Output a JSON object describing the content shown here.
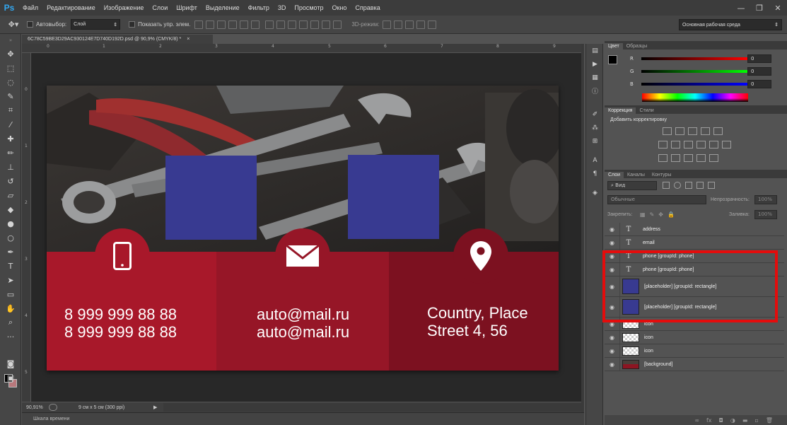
{
  "app": {
    "logo": "Ps"
  },
  "menu": [
    "Файл",
    "Редактирование",
    "Изображение",
    "Слои",
    "Шрифт",
    "Выделение",
    "Фильтр",
    "3D",
    "Просмотр",
    "Окно",
    "Справка"
  ],
  "window_controls": [
    "—",
    "❐",
    "✕"
  ],
  "options": {
    "autoselect_label": "Автовыбор:",
    "autoselect_value": "Слой",
    "show_transform_label": "Показать упр. элем.",
    "mode3d_label": "3D-режим:",
    "workspace": "Основная рабочая среда"
  },
  "document": {
    "tab_title": "6C78C59BE3D29AC930124E7D740D192D.psd @ 90,9% (CMYK/8) *",
    "tab_close": "×",
    "ruler_h_labels": [
      "0",
      "1",
      "2",
      "3",
      "4",
      "5",
      "6",
      "7",
      "8",
      "9"
    ],
    "ruler_v_labels": [
      "0",
      "1",
      "2",
      "3",
      "4",
      "5"
    ]
  },
  "card": {
    "phone_line1": "8 999 999 88 88",
    "phone_line2": "8 999 999 88 88",
    "email_line1": "auto@mail.ru",
    "email_line2": "auto@mail.ru",
    "address_line1": "Country, Place",
    "address_line2": "Street 4, 56",
    "colors": {
      "col1": "#a8182a",
      "col2": "#961627",
      "col3": "#7c1120",
      "placeholder": "#383a91"
    }
  },
  "status": {
    "zoom": "90,91%",
    "doc_info": "9 см x 5 см (300 ppi)"
  },
  "timeline": {
    "label": "Шкала времени"
  },
  "color_panel": {
    "tabs": [
      "Цвет",
      "Образцы"
    ],
    "channels": [
      {
        "letter": "R",
        "value": "0"
      },
      {
        "letter": "G",
        "value": "0"
      },
      {
        "letter": "B",
        "value": "0"
      }
    ]
  },
  "adjustments_panel": {
    "tabs": [
      "Коррекция",
      "Стили"
    ],
    "title": "Добавить корректировку"
  },
  "layers_panel": {
    "tabs": [
      "Слои",
      "Каналы",
      "Контуры"
    ],
    "filter_kind": "Вид",
    "blend_mode": "Обычные",
    "opacity_label": "Непрозрачность:",
    "opacity_value": "100%",
    "lock_label": "Закрепить:",
    "fill_label": "Заливка:",
    "fill_value": "100%",
    "eye_glyph": "◉",
    "type_glyph": "T",
    "layers": [
      {
        "name": "address",
        "kind": "text"
      },
      {
        "name": "email",
        "kind": "text"
      },
      {
        "name": "phone [groupId: phone]",
        "kind": "text"
      },
      {
        "name": "phone [groupId: phone]",
        "kind": "text"
      },
      {
        "name": "[placeholder] [groupId: rectangle]",
        "kind": "placeholder"
      },
      {
        "name": "[placeholder] [groupId: rectangle]",
        "kind": "placeholder"
      },
      {
        "name": "icon",
        "kind": "icon"
      },
      {
        "name": "icon",
        "kind": "icon"
      },
      {
        "name": "icon",
        "kind": "icon"
      },
      {
        "name": "[background]",
        "kind": "background"
      }
    ]
  }
}
